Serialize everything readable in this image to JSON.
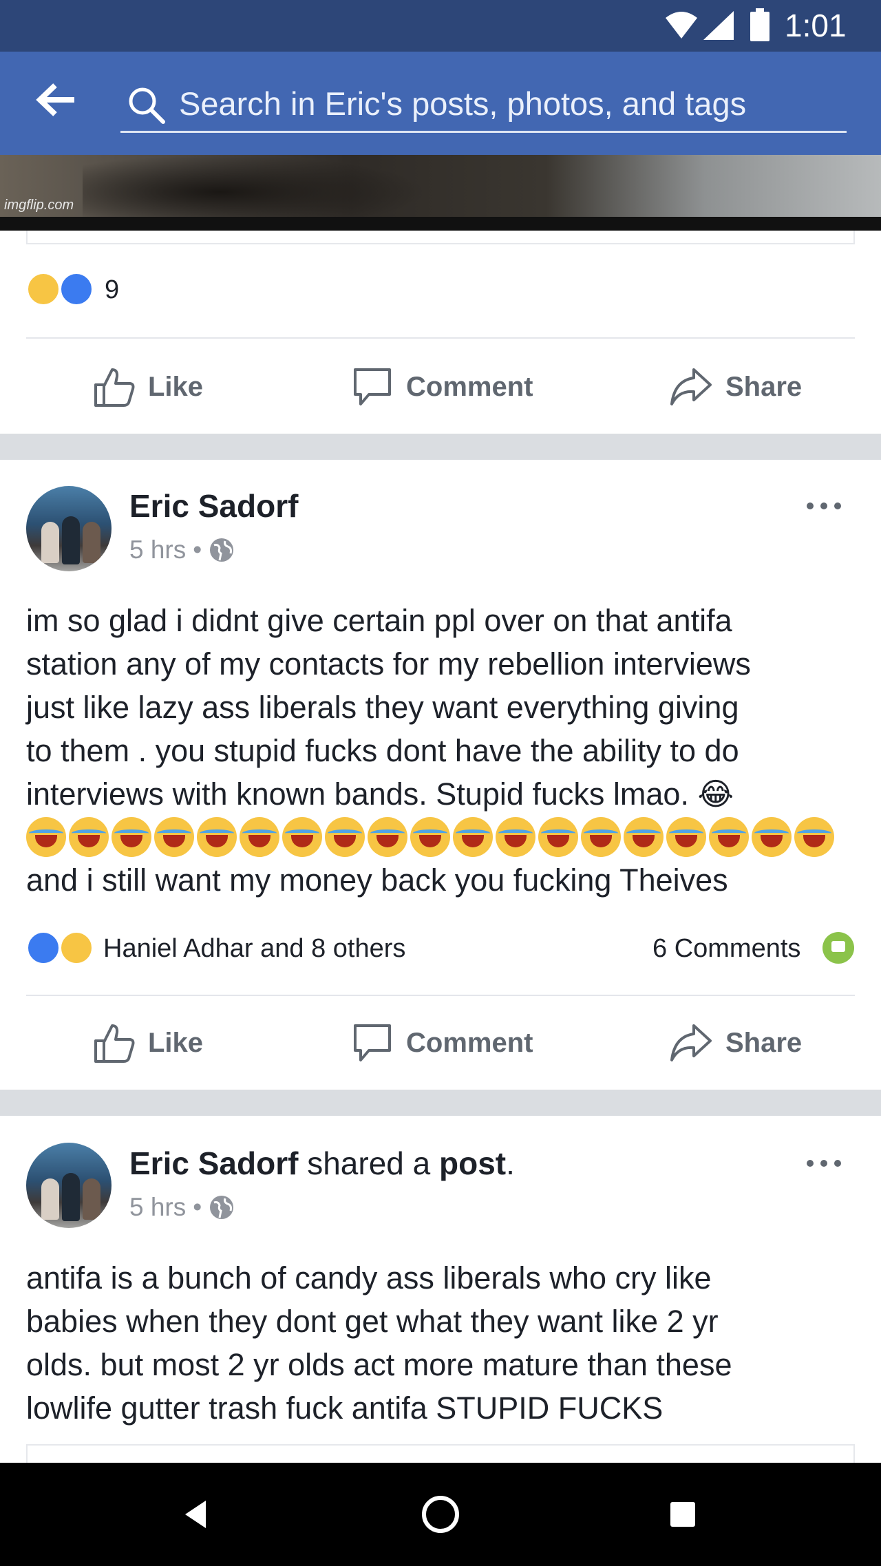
{
  "status_bar": {
    "time": "1:01"
  },
  "header": {
    "search_placeholder": "Search in Eric's posts, photos, and tags"
  },
  "media": {
    "watermark": "imgflip.com"
  },
  "previous_post": {
    "reactions": [
      "haha",
      "like"
    ],
    "reaction_count": "9",
    "actions": {
      "like": "Like",
      "comment": "Comment",
      "share": "Share"
    }
  },
  "posts": [
    {
      "author": "Eric Sadorf",
      "time": "5 hrs",
      "privacy_icon": "globe-icon",
      "text_lines": [
        "im so glad i didnt give certain ppl over  on that antifa",
        "station any of my contacts for my rebellion interviews",
        "just like  lazy ass liberals they want  everything  giving",
        "to them . you stupid fucks  dont have  the ability to do",
        "interviews with known bands. Stupid fucks lmao. 😂",
        "and i still want my money back you  fucking  Theives"
      ],
      "emoji_row_count": 19,
      "reactions": [
        "like",
        "haha"
      ],
      "reactors": "Haniel Adhar and 8 others",
      "comments": "6 Comments",
      "actions": {
        "like": "Like",
        "comment": "Comment",
        "share": "Share"
      }
    },
    {
      "author": "Eric Sadorf",
      "shared_verb": "shared a",
      "shared_object": "post",
      "time": "5 hrs",
      "privacy_icon": "globe-icon",
      "text_lines": [
        "antifa is a bunch of candy ass liberals who cry  like",
        "babies when they  dont get what they want like  2 yr",
        "olds. but most 2 yr olds act more mature than these",
        "lowlife gutter trash fuck antifa STUPID FUCKS"
      ]
    }
  ],
  "colors": {
    "status_bar": "#2d4678",
    "header": "#4267b2",
    "separator": "#dadde1",
    "muted_text": "#90949c",
    "action_text": "#606770",
    "comment_badge": "#8bc34a",
    "like_blue": "#3b7bf0",
    "haha_yellow": "#f7c544"
  }
}
